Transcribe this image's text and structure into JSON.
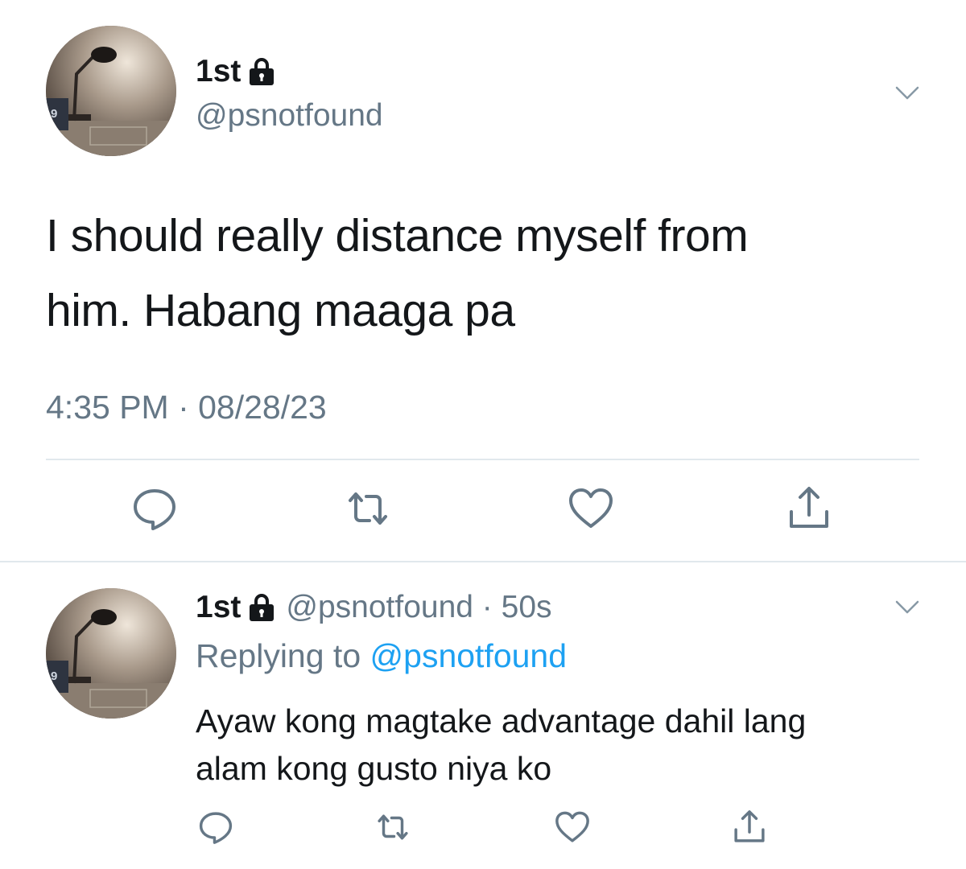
{
  "main_tweet": {
    "display_name": "1st",
    "handle": "@psnotfound",
    "text_lines": [
      "I should really distance myself from",
      "him. Habang maaga pa"
    ],
    "timestamp": "4:35 PM · 08/28/23",
    "icons": {
      "lock": "lock-icon",
      "caret": "chevron-down-icon",
      "reply": "reply-icon",
      "retweet": "retweet-icon",
      "like": "heart-icon",
      "share": "share-icon"
    }
  },
  "reply_tweet": {
    "display_name": "1st",
    "handle": "@psnotfound",
    "separator": " · ",
    "time_ago": "50s",
    "replying_prefix": "Replying to ",
    "replying_to": "@psnotfound",
    "text_lines": [
      "Ayaw kong magtake advantage dahil lang",
      "alam kong gusto niya ko"
    ]
  },
  "colors": {
    "text_primary": "#14171a",
    "text_secondary": "#657786",
    "link": "#1da1f2",
    "divider": "#e1e8ed",
    "icon": "#657786"
  }
}
